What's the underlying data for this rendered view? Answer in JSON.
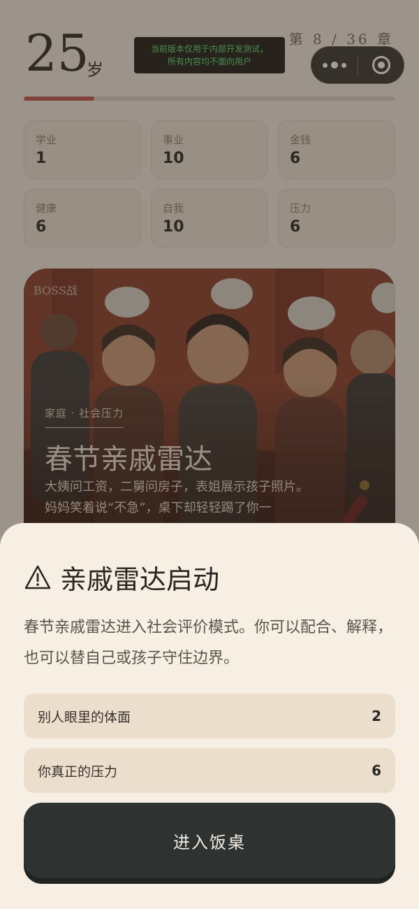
{
  "header": {
    "age": "25",
    "age_unit": "岁",
    "chapter": "第 8 / 36 章",
    "progress_fraction": 0.19
  },
  "dev_notice": {
    "line1": "当前版本仅用于内部开发测试，",
    "line2": "所有内容均不面向用户"
  },
  "capsule": {
    "more_icon": "more-dots-icon",
    "close_icon": "target-circle-icon"
  },
  "stats": [
    {
      "label": "学业",
      "value": "1"
    },
    {
      "label": "事业",
      "value": "10"
    },
    {
      "label": "金钱",
      "value": "6"
    },
    {
      "label": "健康",
      "value": "6"
    },
    {
      "label": "自我",
      "value": "10"
    },
    {
      "label": "压力",
      "value": "6"
    }
  ],
  "event_card": {
    "boss_tag": "BOSS战",
    "tags": "家庭 · 社会压力",
    "title": "春节亲戚雷达",
    "description": "大姨问工资，二舅问房子，表姐展示孩子照片。妈妈笑着说“不急”，桌下却轻轻踢了你一"
  },
  "sheet": {
    "icon": "warning-triangle-icon",
    "title": "亲戚雷达启动",
    "description": "春节亲戚雷达进入社会评价模式。你可以配合、解释，也可以替自己或孩子守住边界。",
    "metrics": [
      {
        "label": "别人眼里的体面",
        "value": "2"
      },
      {
        "label": "你真正的压力",
        "value": "6"
      }
    ],
    "button_label": "进入饭桌"
  },
  "colors": {
    "background": "#f3ece2",
    "progress": "#c0584f",
    "button": "#2e3331",
    "dev_notice_text": "#5de06d"
  }
}
